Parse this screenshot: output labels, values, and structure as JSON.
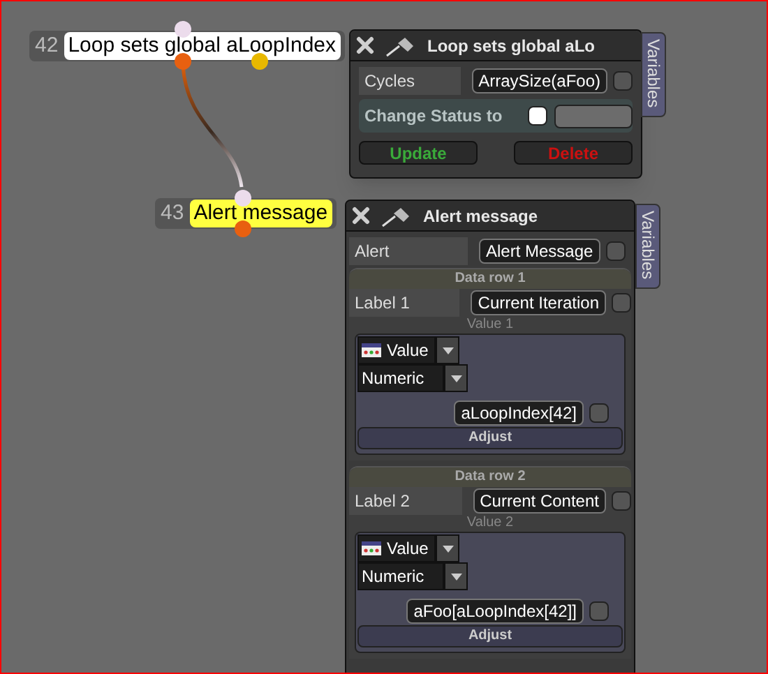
{
  "nodes": [
    {
      "number": "42",
      "label": "Loop sets global aLoopIndex",
      "highlighted": false
    },
    {
      "number": "43",
      "label": "Alert message",
      "highlighted": true
    }
  ],
  "panels": [
    {
      "title": "Loop sets global aLo",
      "tab": "Variables",
      "fields": [
        {
          "label": "Cycles",
          "value": "ArraySize(aFoo)",
          "checked": false
        }
      ],
      "status": {
        "label": "Change Status to",
        "checked": false
      },
      "buttons": [
        {
          "label": "Update",
          "kind": "update"
        },
        {
          "label": "Delete",
          "kind": "delete"
        }
      ]
    },
    {
      "title": "Alert message",
      "tab": "Variables",
      "fields": [
        {
          "label": "Alert",
          "value": "Alert Message",
          "checked": false
        }
      ],
      "data_rows": [
        {
          "header": "Data row 1",
          "label": "Label 1",
          "value": "Current Iteration",
          "checked": false,
          "caption": "Value 1",
          "source": "Value",
          "type": "Numeric",
          "expression": "aLoopIndex[42]",
          "expression_checked": false,
          "button": "Adjust"
        },
        {
          "header": "Data row 2",
          "label": "Label 2",
          "value": "Current Content",
          "checked": false,
          "caption": "Value 2",
          "source": "Value",
          "type": "Numeric",
          "expression": "aFoo[aLoopIndex[42]]",
          "expression_checked": false,
          "button": "Adjust"
        }
      ]
    }
  ]
}
